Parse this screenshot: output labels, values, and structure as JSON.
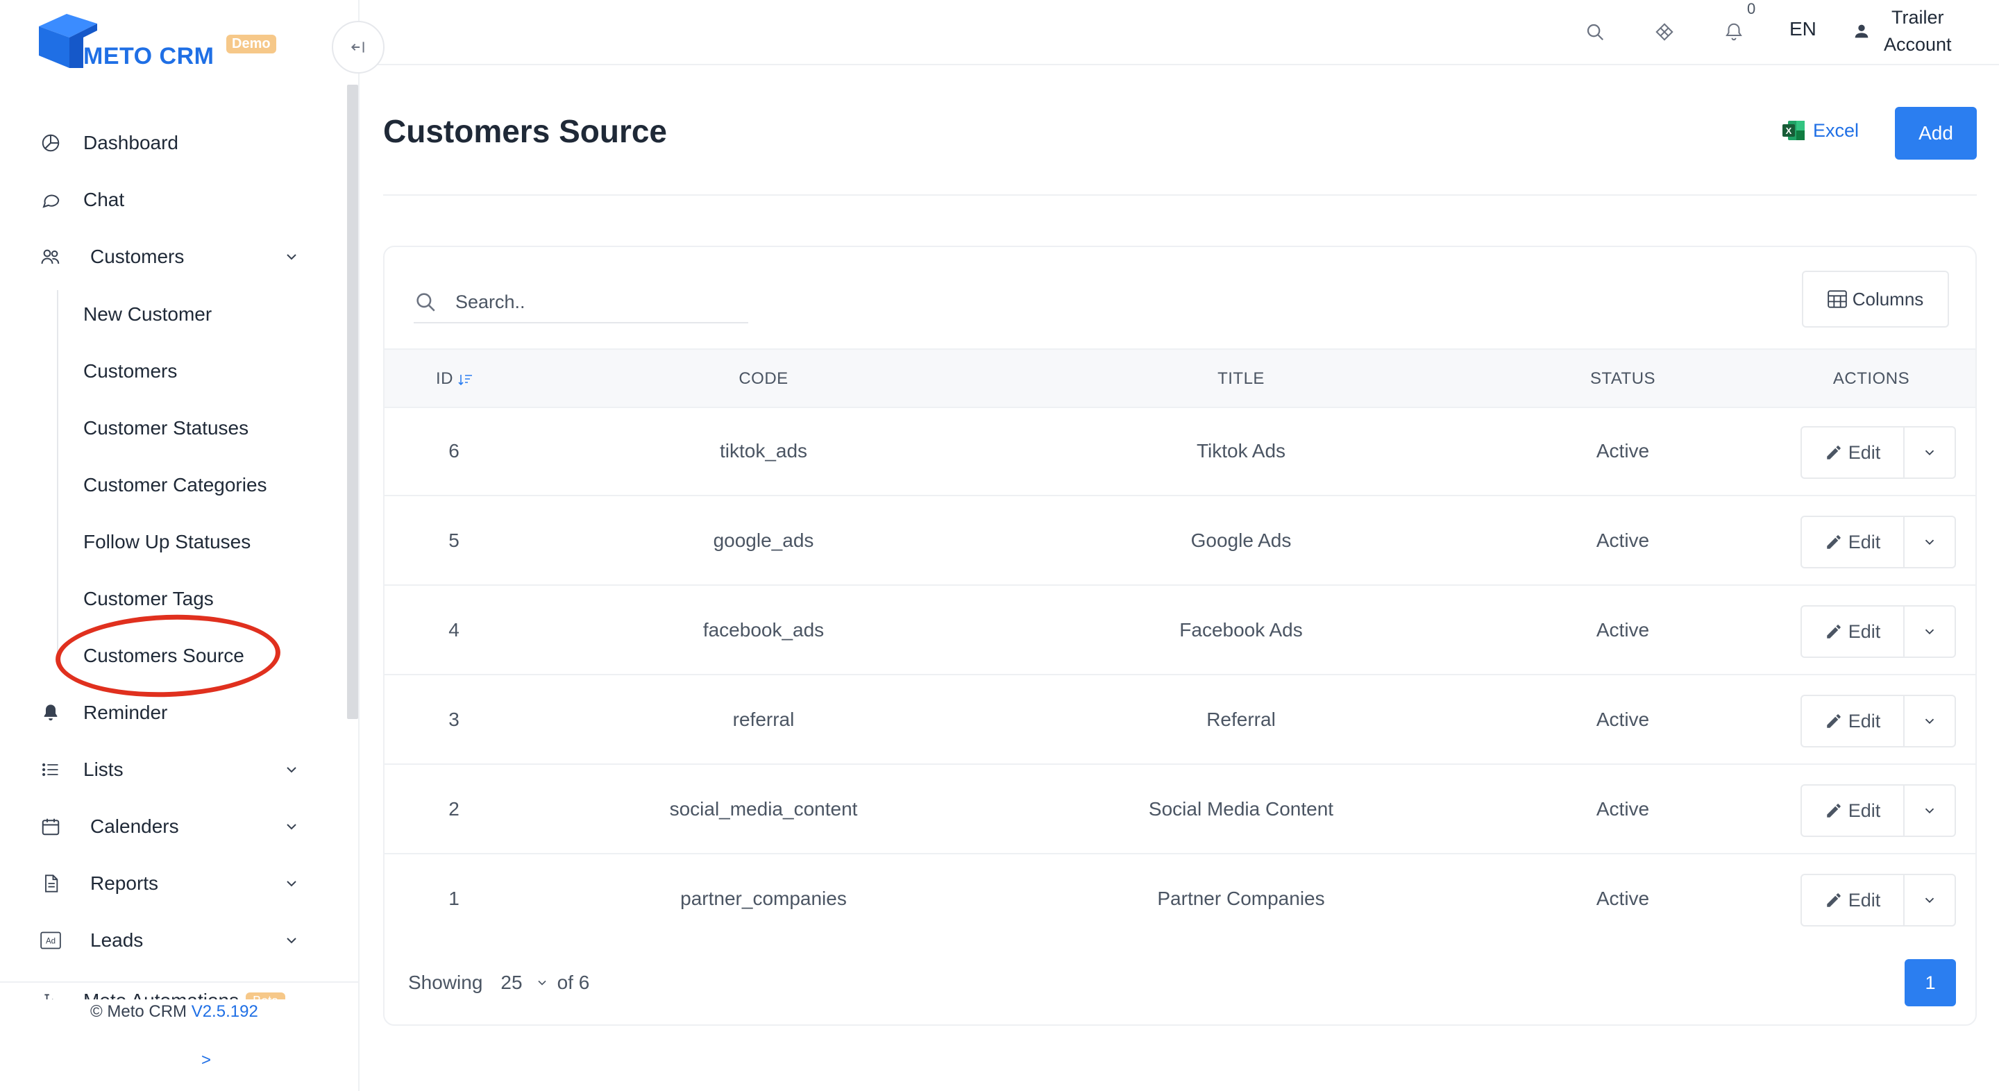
{
  "brand": {
    "name": "METO CRM",
    "badge": "Demo",
    "primary_color": "#1f6fe5"
  },
  "sidebar": {
    "items": [
      {
        "label": "Dashboard",
        "icon": "pie-chart-icon"
      },
      {
        "label": "Chat",
        "icon": "chat-bubble-icon"
      },
      {
        "label": "Customers",
        "icon": "users-icon",
        "expanded": true
      },
      {
        "label": "Reminder",
        "icon": "bell-icon"
      },
      {
        "label": "Lists",
        "icon": "list-icon"
      },
      {
        "label": "Calenders",
        "icon": "calendar-icon"
      },
      {
        "label": "Reports",
        "icon": "document-icon"
      },
      {
        "label": "Leads",
        "icon": "ad-icon"
      },
      {
        "label": "Meto Automations",
        "icon": "automation-icon",
        "badge": "Beta"
      }
    ],
    "customers_sub": [
      "New Customer",
      "Customers",
      "Customer Statuses",
      "Customer Categories",
      "Follow Up Statuses",
      "Customer Tags",
      "Customers Source"
    ],
    "active_sub": "Customers Source",
    "copyright": "© Meto CRM",
    "version": "V2.5.192",
    "expand_label": ">"
  },
  "topbar": {
    "notification_count": "0",
    "language": "EN",
    "account_line1": "Trailer",
    "account_line2": "Account"
  },
  "page": {
    "title": "Customers Source",
    "excel_label": "Excel",
    "add_label": "Add"
  },
  "table": {
    "search_placeholder": "Search..",
    "columns_label": "Columns",
    "headers": {
      "id": "ID",
      "code": "CODE",
      "title": "TITLE",
      "status": "STATUS",
      "actions": "ACTIONS"
    },
    "rows": [
      {
        "id": "6",
        "code": "tiktok_ads",
        "title": "Tiktok Ads",
        "status": "Active"
      },
      {
        "id": "5",
        "code": "google_ads",
        "title": "Google Ads",
        "status": "Active"
      },
      {
        "id": "4",
        "code": "facebook_ads",
        "title": "Facebook Ads",
        "status": "Active"
      },
      {
        "id": "3",
        "code": "referral",
        "title": "Referral",
        "status": "Active"
      },
      {
        "id": "2",
        "code": "social_media_content",
        "title": "Social Media Content",
        "status": "Active"
      },
      {
        "id": "1",
        "code": "partner_companies",
        "title": "Partner Companies",
        "status": "Active"
      }
    ],
    "edit_label": "Edit",
    "showing_label": "Showing",
    "per_page": "25",
    "of_label": "of 6",
    "current_page": "1"
  }
}
